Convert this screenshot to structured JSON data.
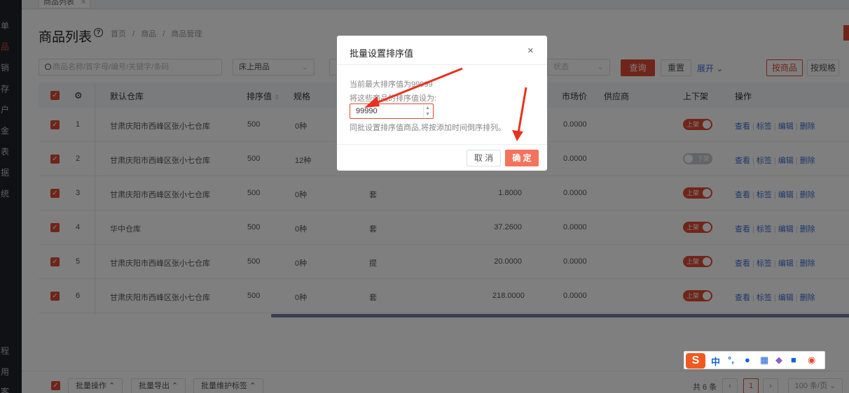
{
  "sidebar": {
    "items": [
      "单",
      "品",
      "销",
      "存",
      "户",
      "金",
      "表",
      "据",
      "统",
      "程",
      "用",
      "客"
    ],
    "active_index": 1
  },
  "tab": {
    "label": "商品列表",
    "close": "×"
  },
  "page": {
    "title": "商品列表",
    "help": "?",
    "breadcrumb": [
      "首页",
      "/",
      "商品",
      "/",
      "商品管理"
    ]
  },
  "filters": {
    "search_placeholder": "商品名称/首字母/编号/关键字/条码",
    "category_value": "床上用品",
    "status_placeholder": "状态",
    "query": "查询",
    "reset": "重置",
    "expand": "展开",
    "by_product": "按商品",
    "by_spec": "按规格"
  },
  "table": {
    "headers": {
      "warehouse": "默认仓库",
      "sort": "排序值",
      "spec": "规格",
      "market_price": "市场价",
      "supplier": "供应商",
      "shelf": "上下架",
      "ops": "操作"
    },
    "rows": [
      {
        "no": "1",
        "warehouse": "甘肃庆阳市西峰区张小七仓库",
        "sort": "500",
        "spec": "0种",
        "unit": "",
        "price": "",
        "market": "0.0000",
        "shelf": "上架",
        "on": true
      },
      {
        "no": "2",
        "warehouse": "甘肃庆阳市西峰区张小七仓库",
        "sort": "500",
        "spec": "12种",
        "unit": "",
        "price": "",
        "market": "0.0000",
        "shelf": "下架",
        "on": false
      },
      {
        "no": "3",
        "warehouse": "甘肃庆阳市西峰区张小七仓库",
        "sort": "500",
        "spec": "0种",
        "unit": "套",
        "price": "1.8000",
        "market": "0.0000",
        "shelf": "上架",
        "on": true
      },
      {
        "no": "4",
        "warehouse": "华中仓库",
        "sort": "500",
        "spec": "0种",
        "unit": "套",
        "price": "37.2600",
        "market": "0.0000",
        "shelf": "上架",
        "on": true
      },
      {
        "no": "5",
        "warehouse": "甘肃庆阳市西峰区张小七仓库",
        "sort": "500",
        "spec": "0种",
        "unit": "提",
        "price": "20.0000",
        "market": "0.0000",
        "shelf": "上架",
        "on": true
      },
      {
        "no": "6",
        "warehouse": "甘肃庆阳市西峰区张小七仓库",
        "sort": "500",
        "spec": "0种",
        "unit": "套",
        "price": "218.0000",
        "market": "0.0000",
        "shelf": "上架",
        "on": true
      }
    ],
    "ops": {
      "view": "查看",
      "tag": "标签",
      "edit": "编辑",
      "delete": "删除"
    }
  },
  "footer": {
    "batch_ops": "批量操作",
    "batch_export": "批量导出",
    "batch_tags": "批量维护标签",
    "total": "共 6 条",
    "current_page": "1",
    "page_size": "100 条/页"
  },
  "modal": {
    "title": "批量设置排序值",
    "close": "×",
    "current_max": "当前最大排序值为99999",
    "set_label": "将这些商品的排序值设为:",
    "input_value": "99990",
    "hint": "同批设置排序值商品,将按添加时间倒序排列。",
    "cancel": "取 消",
    "confirm": "确 定"
  },
  "ime": {
    "items": [
      "中",
      "°,"
    ]
  },
  "colors": {
    "accent": "#e04b34",
    "link": "#3d6ed6",
    "arrow": "#e8321f"
  }
}
